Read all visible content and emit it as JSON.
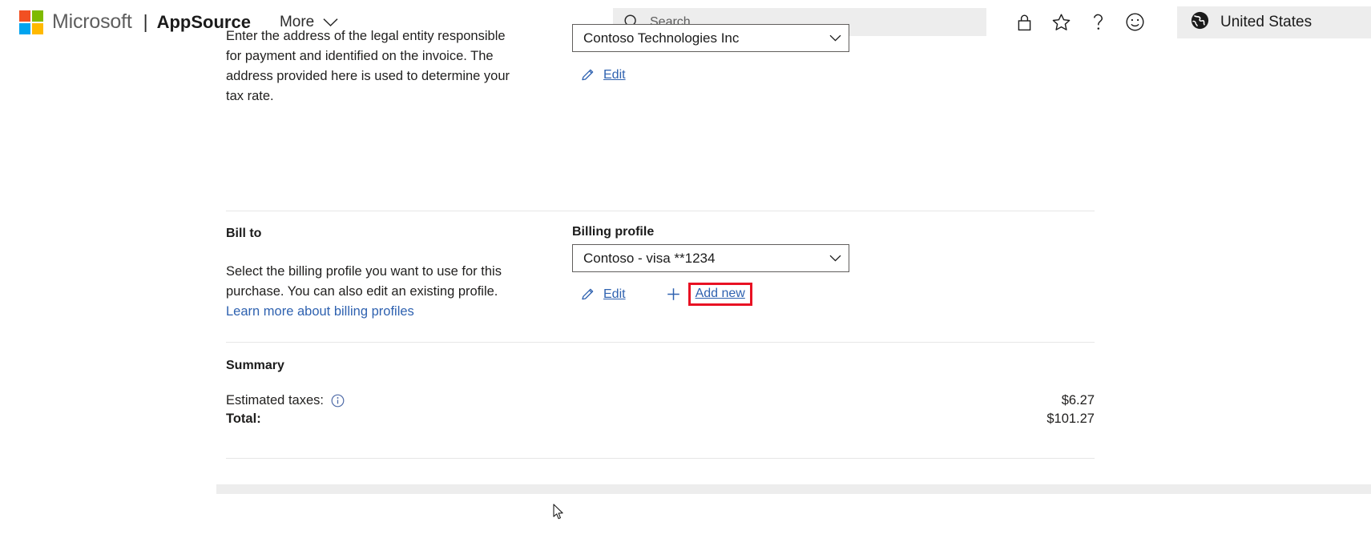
{
  "header": {
    "logo_icon": "microsoft-logo-icon",
    "microsoft_label": "Microsoft",
    "separator": "|",
    "brand_label": "AppSource",
    "more_label": "More",
    "chevron_icon": "chevron-down-icon",
    "search": {
      "icon": "search-icon",
      "placeholder": "Search",
      "value": ""
    },
    "icons": [
      {
        "name": "lock-icon",
        "glyph": "lock"
      },
      {
        "name": "star-icon",
        "glyph": "star"
      },
      {
        "name": "help-icon",
        "glyph": "question"
      },
      {
        "name": "feedback-smiley-icon",
        "glyph": "smiley"
      }
    ],
    "region": {
      "icon": "globe-icon",
      "label": "United States"
    }
  },
  "sell_to": {
    "description": "Enter the address of the legal entity responsible for payment and identified on the invoice. The address provided here is used to determine your tax rate.",
    "combo_value": "Contoso Technologies Inc",
    "edit": {
      "icon": "pencil-icon",
      "label": "Edit"
    }
  },
  "bill_to": {
    "heading": "Bill to",
    "description_part1": "Select the billing profile you want to use for this purchase. You can also edit an existing profile. ",
    "description_link": "Learn more about billing profiles",
    "field_label": "Billing profile",
    "combo_value": "Contoso - visa **1234",
    "combo_arrow_icon": "chevron-down-icon",
    "edit": {
      "icon": "pencil-icon",
      "label": "Edit"
    },
    "add_new": {
      "icon": "plus-icon",
      "label": "Add new",
      "highlight_color": "#e81123",
      "highlighted": true
    }
  },
  "summary": {
    "heading": "Summary",
    "rows": [
      {
        "label": "Estimated taxes:",
        "info_icon": "info-circle-icon",
        "amount": "$6.27",
        "bold": false
      },
      {
        "label": "Total:",
        "info_icon": "",
        "amount": "$101.27",
        "bold": true
      }
    ]
  },
  "cursor": {
    "icon": "mouse-pointer-icon"
  },
  "colors": {
    "link": "#2f62b0",
    "highlight": "#e81123",
    "divider": "#e6e6e6",
    "chrome_gray": "#ededed"
  }
}
